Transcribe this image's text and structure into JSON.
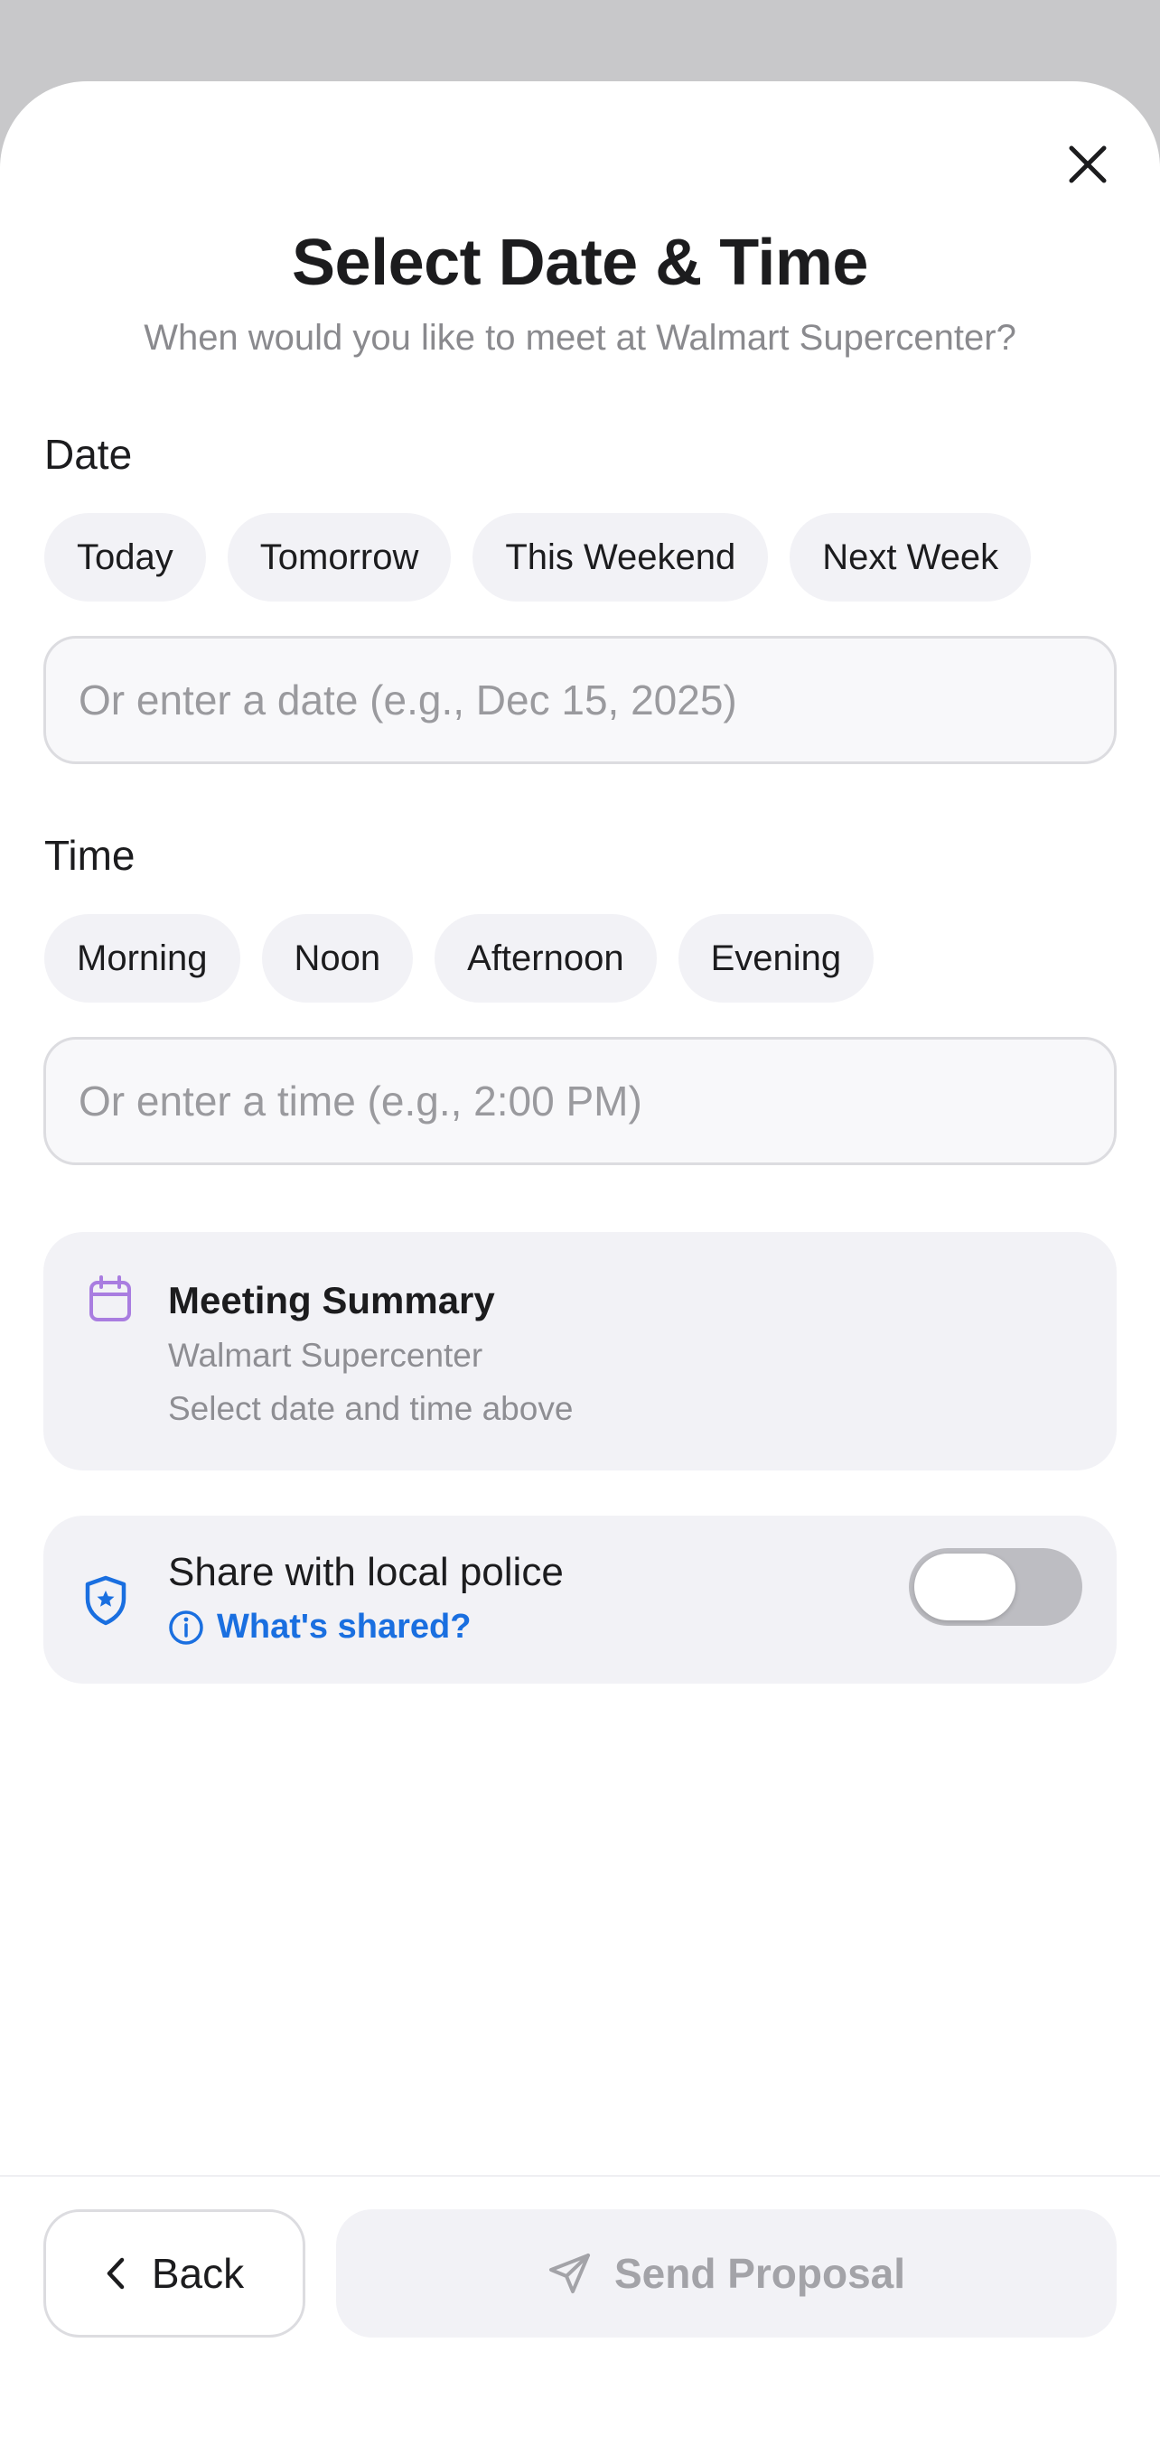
{
  "header": {
    "title": "Select Date & Time",
    "subtitle": "When would you like to meet at Walmart Supercenter?",
    "close_icon": "close-icon"
  },
  "date": {
    "label": "Date",
    "options": [
      "Today",
      "Tomorrow",
      "This Weekend",
      "Next Week"
    ],
    "input_value": "",
    "input_placeholder": "Or enter a date (e.g., Dec 15, 2025)"
  },
  "time": {
    "label": "Time",
    "options": [
      "Morning",
      "Noon",
      "Afternoon",
      "Evening"
    ],
    "input_value": "",
    "input_placeholder": "Or enter a time (e.g., 2:00 PM)"
  },
  "summary": {
    "icon": "calendar-icon",
    "title": "Meeting Summary",
    "location": "Walmart Supercenter",
    "status": "Select date and time above"
  },
  "police": {
    "icon": "police-shield-icon",
    "title": "Share with local police",
    "info_icon": "info-icon",
    "link_label": "What's shared?",
    "toggle_on": false
  },
  "footer": {
    "back_label": "Back",
    "back_icon": "chevron-left-icon",
    "send_label": "Send Proposal",
    "send_icon": "send-icon",
    "send_enabled": false
  },
  "colors": {
    "accent_blue": "#1a6fe0",
    "calendar_purple": "#a97de0",
    "chip_background": "#f2f2f6",
    "disabled_text": "#a3a3a8",
    "toggle_off": "#bdbdc2"
  }
}
